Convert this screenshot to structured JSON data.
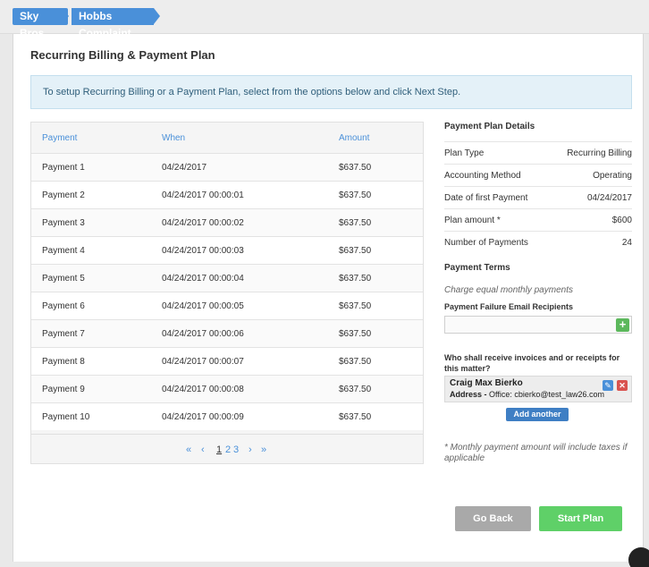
{
  "breadcrumbs": [
    "Sky Bros",
    "Hobbs Complaint"
  ],
  "page_title": "Recurring Billing & Payment Plan",
  "info_text": "To setup Recurring Billing or a Payment Plan, select from the options below and click Next Step.",
  "table": {
    "headers": [
      "Payment",
      "When",
      "Amount"
    ],
    "rows": [
      {
        "payment": "Payment 1",
        "when": "04/24/2017",
        "amount": "$637.50"
      },
      {
        "payment": "Payment 2",
        "when": "04/24/2017 00:00:01",
        "amount": "$637.50"
      },
      {
        "payment": "Payment 3",
        "when": "04/24/2017 00:00:02",
        "amount": "$637.50"
      },
      {
        "payment": "Payment 4",
        "when": "04/24/2017 00:00:03",
        "amount": "$637.50"
      },
      {
        "payment": "Payment 5",
        "when": "04/24/2017 00:00:04",
        "amount": "$637.50"
      },
      {
        "payment": "Payment 6",
        "when": "04/24/2017 00:00:05",
        "amount": "$637.50"
      },
      {
        "payment": "Payment 7",
        "when": "04/24/2017 00:00:06",
        "amount": "$637.50"
      },
      {
        "payment": "Payment 8",
        "when": "04/24/2017 00:00:07",
        "amount": "$637.50"
      },
      {
        "payment": "Payment 9",
        "when": "04/24/2017 00:00:08",
        "amount": "$637.50"
      },
      {
        "payment": "Payment 10",
        "when": "04/24/2017 00:00:09",
        "amount": "$637.50"
      }
    ]
  },
  "pager": {
    "first": "«",
    "prev": "‹",
    "pages": [
      "1",
      "2",
      "3"
    ],
    "next": "›",
    "last": "»"
  },
  "details": {
    "title": "Payment Plan Details",
    "items": [
      {
        "label": "Plan Type",
        "value": "Recurring Billing"
      },
      {
        "label": "Accounting Method",
        "value": "Operating"
      },
      {
        "label": "Date of first Payment",
        "value": "04/24/2017"
      },
      {
        "label": "Plan amount *",
        "value": "$600"
      },
      {
        "label": "Number of Payments",
        "value": "24"
      }
    ],
    "terms_title": "Payment Terms",
    "terms_text": "Charge equal monthly payments",
    "failure_label": "Payment Failure Email Recipients",
    "recipients_question": "Who shall receive invoices and or receipts for this matter?",
    "contact_name": "Craig Max Bierko",
    "contact_address_label": "Address -",
    "contact_address": "Office: cbierko@test_law26.com",
    "add_another": "Add another",
    "footnote": "* Monthly payment amount will include taxes if applicable"
  },
  "buttons": {
    "go_back": "Go Back",
    "start_plan": "Start Plan"
  }
}
